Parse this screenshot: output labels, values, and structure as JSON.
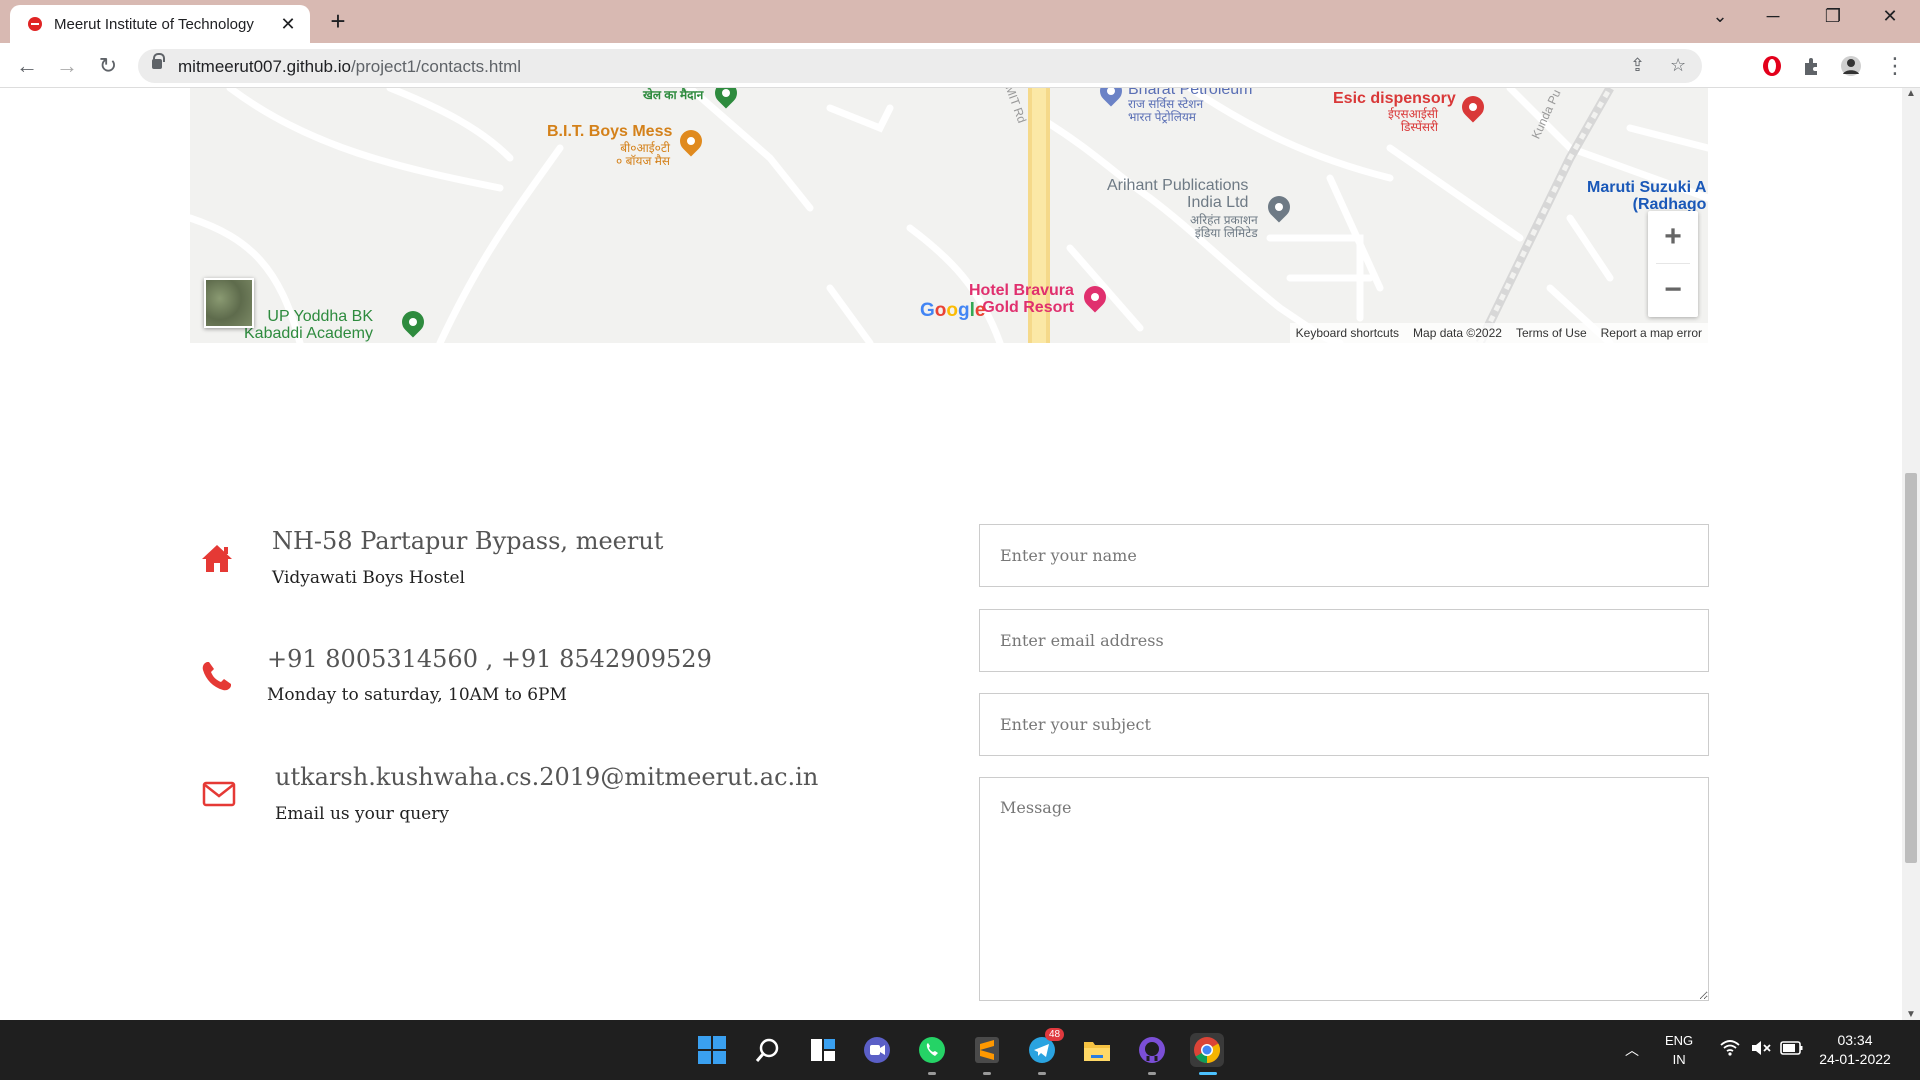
{
  "browser": {
    "tab_title": "Meerut Institute of Technology",
    "tab_close": "✕",
    "new_tab": "+",
    "url_host": "mitmeerut007.github.io",
    "url_path": "/project1/contacts.html",
    "window_buttons": {
      "minimize": "─",
      "restore": "❐",
      "close": "✕",
      "tabs_menu": "⌄"
    }
  },
  "map": {
    "places": [
      {
        "name": "खेल का मैदान",
        "color": "#2e8b3e"
      },
      {
        "name": "B.I.T. Boys Mess",
        "sub": "बी०आई०टी\n० बॉयज मैस",
        "color": "#e08a1e"
      },
      {
        "name": "Bharat Petroleum",
        "sub": "राज सर्विस स्टेशन\nभारत पेट्रोलियम",
        "color": "#6b82c6"
      },
      {
        "name": "Esic dispensory",
        "sub": "ईएसआईसी\nडिस्पेंसरी",
        "color": "#d93838"
      },
      {
        "name": "Arihant Publications\nIndia Ltd",
        "sub": "अरिहंत प्रकाशन\nइंडिया लिमिटेड",
        "color": "#6e7a85"
      },
      {
        "name": "Maruti Suzuki A\n(Radhago",
        "color": "#1a58b8"
      },
      {
        "name": "Hotel Bravura\nGold Resort",
        "color": "#e0306e"
      },
      {
        "name": "UP Yoddha BK\nKabaddi Academy",
        "color": "#2e8b3e"
      }
    ],
    "road_labels": [
      "MIT Rd",
      "Kunda Pu"
    ],
    "zoom_in": "+",
    "zoom_out": "−",
    "google": "Google",
    "footer": [
      "Keyboard shortcuts",
      "Map data ©2022",
      "Terms of Use",
      "Report a map error"
    ]
  },
  "contact": {
    "address_title": "NH-58 Partapur Bypass, meerut",
    "address_sub": "Vidyawati Boys Hostel",
    "phone_title": "+91 8005314560 , +91 8542909529",
    "phone_sub": "Monday to saturday, 10AM to 6PM",
    "email_title": "utkarsh.kushwaha.cs.2019@mitmeerut.ac.in",
    "email_sub": "Email us your query"
  },
  "form": {
    "name_placeholder": "Enter your name",
    "email_placeholder": "Enter email address",
    "subject_placeholder": "Enter your subject",
    "message_placeholder": "Message"
  },
  "taskbar": {
    "telegram_badge": "48",
    "lang_line1": "ENG",
    "lang_line2": "IN",
    "time": "03:34",
    "date": "24-01-2022"
  },
  "colors": {
    "accent_red": "#e53935",
    "titlebar": "#d8b9b2",
    "taskbar": "#1f1f1f"
  }
}
